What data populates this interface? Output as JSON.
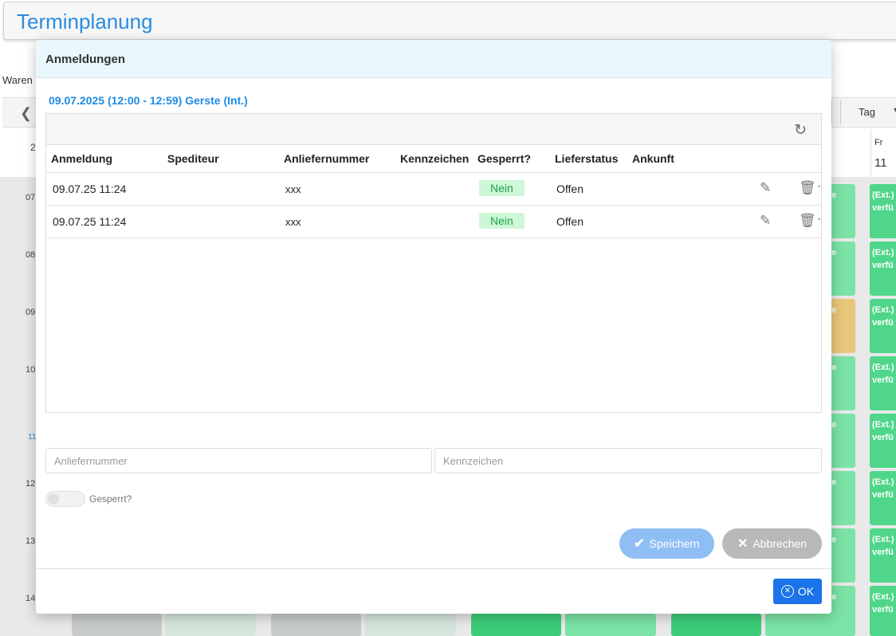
{
  "app": {
    "title": "Terminplanung",
    "left_label": "Waren",
    "view_label": "Tag",
    "day_name": "Fr",
    "day_number": "11",
    "col_fragment": "2",
    "hours": [
      "07",
      "08",
      "09",
      "10",
      "11",
      "12",
      "13",
      "14"
    ],
    "slot_text_line1": "(Ext.)",
    "slot_text_line2": "verfü",
    "slot_fragment": "e"
  },
  "modal": {
    "title": "Anmeldungen",
    "slot_title": "09.07.2025 (12:00 - 12:59) Gerste (Int.)",
    "columns": [
      "Anmeldung",
      "Spediteur",
      "Anliefernummer",
      "Kennzeichen",
      "Gesperrt?",
      "Lieferstatus",
      "Ankunft"
    ],
    "rows": [
      {
        "anmeldung": "09.07.25 11:24",
        "spediteur": "",
        "anliefernummer": "xxx",
        "kennzeichen": "",
        "gesperrt": "Nein",
        "lieferstatus": "Offen",
        "ankunft": ""
      },
      {
        "anmeldung": "09.07.25 11:24",
        "spediteur": "",
        "anliefernummer": "xxx",
        "kennzeichen": "",
        "gesperrt": "Nein",
        "lieferstatus": "Offen",
        "ankunft": ""
      }
    ],
    "form": {
      "anliefernummer_placeholder": "Anliefernummer",
      "kennzeichen_placeholder": "Kennzeichen",
      "gesperrt_label": "Gesperrt?",
      "gesperrt_value": false
    },
    "buttons": {
      "save": "Speichern",
      "cancel": "Abbrechen",
      "ok": "OK"
    },
    "icons": {
      "refresh": "refresh-icon",
      "edit": "pencil-icon",
      "delete": "trash-icon",
      "more": "more-icon",
      "check": "check-icon",
      "close": "close-icon",
      "ok": "circle-x-icon"
    }
  }
}
